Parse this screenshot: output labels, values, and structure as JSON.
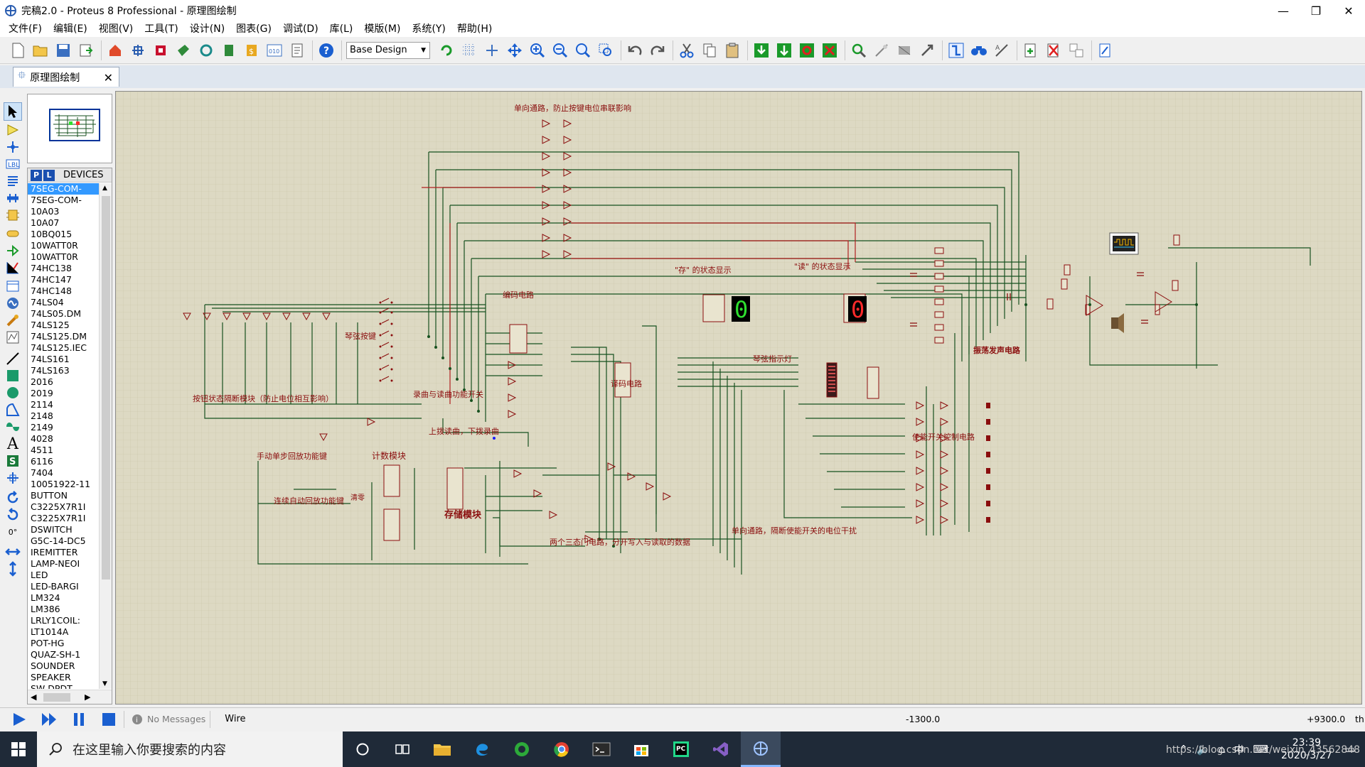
{
  "window": {
    "title": "完稿2.0 - Proteus 8 Professional - 原理图绘制",
    "minimize": "—",
    "maximize": "❐",
    "close": "✕"
  },
  "menu": [
    "文件(F)",
    "编辑(E)",
    "视图(V)",
    "工具(T)",
    "设计(N)",
    "图表(G)",
    "调试(D)",
    "库(L)",
    "模版(M)",
    "系统(Y)",
    "帮助(H)"
  ],
  "toolbar": {
    "design_select": "Base Design"
  },
  "tab": {
    "label": "原理图绘制",
    "close": "✕"
  },
  "devices": {
    "p_label": "P",
    "l_label": "L",
    "header": "DEVICES",
    "items": [
      "7SEG-COM-",
      "7SEG-COM-",
      "10A03",
      "10A07",
      "10BQ015",
      "10WATT0R",
      "10WATT0R",
      "74HC138",
      "74HC147",
      "74HC148",
      "74LS04",
      "74LS05.DM",
      "74LS125",
      "74LS125.DM",
      "74LS125.IEC",
      "74LS161",
      "74LS163",
      "2016",
      "2019",
      "2114",
      "2148",
      "2149",
      "4028",
      "4511",
      "6116",
      "7404",
      "10051922-11",
      "BUTTON",
      "C3225X7R1I",
      "C3225X7R1I",
      "DSWITCH",
      "G5C-14-DC5",
      "IREMITTER",
      "LAMP-NEOI",
      "LED",
      "LED-BARGI",
      "LM324",
      "LM386",
      "LRLY1COIL:",
      "LT1014A",
      "POT-HG",
      "QUAZ-SH-1",
      "SOUNDER",
      "SPEAKER",
      "SW-DPDT"
    ],
    "selected_index": 0
  },
  "left_tools": {
    "rotation_value": "0°"
  },
  "schematic": {
    "labels": {
      "top": "单向通路，防止按键电位串联影响",
      "store_display": "\"存\" 的状态显示",
      "read_display": "\"读\" 的状态显示",
      "encoder": "编码电路",
      "keys": "琴弦按键",
      "key_isolation": "按钮状态隔断模块（防止电位相互影响）",
      "record_switch": "录曲与读曲功能开关",
      "up_read": "上拨读曲，下拨录曲",
      "decoder": "译码电路",
      "string_led": "琴弦指示灯",
      "oscillator": "振荡发声电路",
      "enable_switch": "使能开关控制电路",
      "manual_play": "手动单步回放功能键",
      "counter": "计数模块",
      "auto_play": "连续自动回放功能键",
      "clear": "清零",
      "memory": "存储模块",
      "tristate": "两个三态门电路，分开写入与读取的数据",
      "unidirectional": "单向通路，隔断使能开关的电位干扰"
    },
    "digit_store": "0",
    "digit_read": "0"
  },
  "status": {
    "messages": "No Messages",
    "mode": "Wire",
    "coord_x": "-1300.0",
    "coord_y": "+9300.0",
    "unit": "th"
  },
  "taskbar": {
    "search_placeholder": "在这里输入你要搜索的内容",
    "time": "23:39",
    "date": "2020/3/27",
    "ime": "中",
    "watermark": "https://blog.csdn.net/weixin_43562848"
  },
  "colors": {
    "canvas": "#ddd9c3",
    "wire": "#17511f",
    "wire_red": "#b02020",
    "label": "#8a0d0d",
    "seg_green": "#2fe02f",
    "seg_red": "#ff2a2a"
  }
}
